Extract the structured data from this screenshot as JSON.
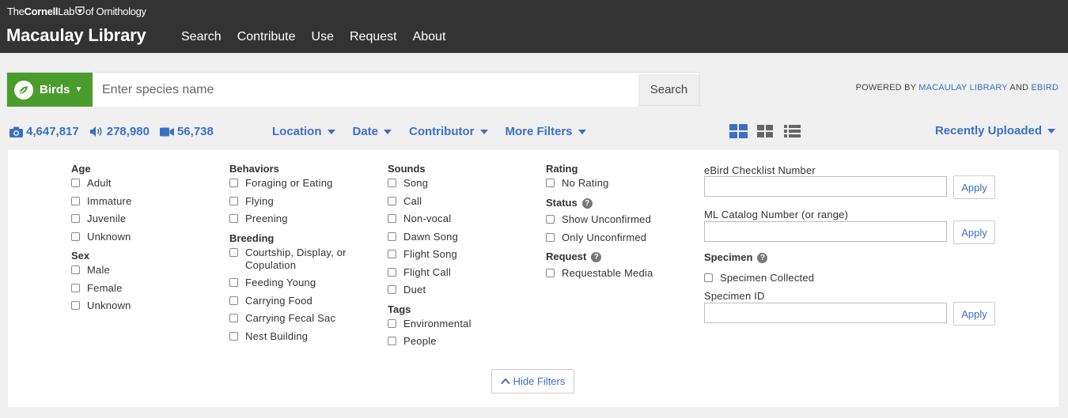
{
  "header": {
    "lab_logo": {
      "the": "The",
      "cornell": "Cornell",
      "lab": "Lab",
      "ornithology": "of Ornithology"
    },
    "site_title": "Macaulay Library",
    "nav": [
      "Search",
      "Contribute",
      "Use",
      "Request",
      "About"
    ]
  },
  "search": {
    "taxon_button": "Birds",
    "placeholder": "Enter species name",
    "submit_label": "Search"
  },
  "powered_by": {
    "prefix": "POWERED BY ",
    "link1": "MACAULAY LIBRARY",
    "and": " AND ",
    "link2": "EBIRD"
  },
  "stats": {
    "photos": "4,647,817",
    "audio": "278,980",
    "video": "56,738"
  },
  "filters": [
    "Location",
    "Date",
    "Contributor",
    "More Filters"
  ],
  "sort_label": "Recently Uploaded",
  "panel": {
    "age": {
      "title": "Age",
      "options": [
        "Adult",
        "Immature",
        "Juvenile",
        "Unknown"
      ]
    },
    "sex": {
      "title": "Sex",
      "options": [
        "Male",
        "Female",
        "Unknown"
      ]
    },
    "behaviors": {
      "title": "Behaviors",
      "options": [
        "Foraging or Eating",
        "Flying",
        "Preening"
      ]
    },
    "breeding": {
      "title": "Breeding",
      "options": [
        "Courtship, Display, or Copulation",
        "Feeding Young",
        "Carrying Food",
        "Carrying Fecal Sac",
        "Nest Building"
      ]
    },
    "sounds": {
      "title": "Sounds",
      "options": [
        "Song",
        "Call",
        "Non-vocal",
        "Dawn Song",
        "Flight Song",
        "Flight Call",
        "Duet"
      ]
    },
    "tags": {
      "title": "Tags",
      "options": [
        "Environmental",
        "People"
      ]
    },
    "rating": {
      "title": "Rating",
      "options": [
        "No Rating"
      ]
    },
    "status": {
      "title": "Status",
      "options": [
        "Show Unconfirmed",
        "Only Unconfirmed"
      ]
    },
    "request": {
      "title": "Request",
      "options": [
        "Requestable Media"
      ]
    },
    "ebird_label": "eBird Checklist Number",
    "ml_label": "ML Catalog Number (or range)",
    "specimen": {
      "title": "Specimen",
      "options": [
        "Specimen Collected"
      ]
    },
    "specimen_id_label": "Specimen ID",
    "apply_label": "Apply",
    "hide_filters": "Hide Filters"
  },
  "colors": {
    "header_bg": "#333333",
    "accent_blue": "#3c6fc4",
    "birds_green": "#4a9c2d"
  }
}
